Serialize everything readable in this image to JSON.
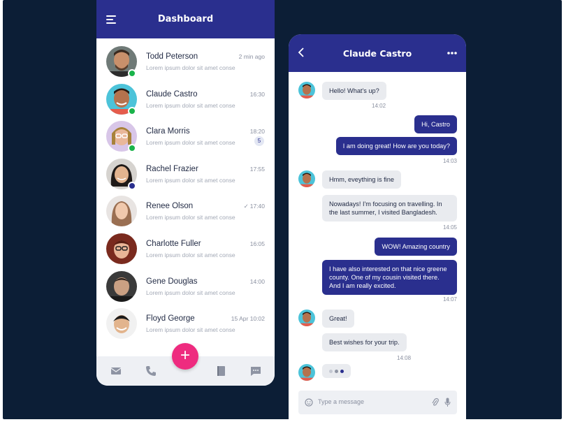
{
  "colors": {
    "primary": "#2a2f8e",
    "accent": "#ee2b7f",
    "online": "#19b34a",
    "background": "#0c1e36"
  },
  "dashboard": {
    "title": "Dashboard",
    "conversations": [
      {
        "name": "Todd Peterson",
        "preview": "Lorem ipsum dolor sit amet conse",
        "time": "2 min ago",
        "status": "online"
      },
      {
        "name": "Claude Castro",
        "preview": "Lorem ipsum dolor sit amet conse",
        "time": "16:30",
        "status": "online"
      },
      {
        "name": "Clara Morris",
        "preview": "Lorem ipsum dolor sit amet conse",
        "time": "18:20",
        "status": "online",
        "unread": "5"
      },
      {
        "name": "Rachel Frazier",
        "preview": "Lorem ipsum dolor sit amet conse",
        "time": "17:55",
        "status": "away"
      },
      {
        "name": "Renee Olson",
        "preview": "Lorem ipsum dolor sit amet conse",
        "time": "17:40",
        "read": "✓"
      },
      {
        "name": "Charlotte Fuller",
        "preview": "Lorem ipsum dolor sit amet conse",
        "time": "16:05"
      },
      {
        "name": "Gene Douglas",
        "preview": "Lorem ipsum dolor sit amet conse",
        "time": "14:00"
      },
      {
        "name": "Floyd George",
        "preview": "Lorem ipsum dolor sit amet conse",
        "time": "15 Apr 10:02"
      }
    ],
    "fab_label": "+",
    "footer_icons": [
      "mail-icon",
      "phone-icon",
      "book-icon",
      "chat-icon"
    ]
  },
  "chat": {
    "title": "Claude Castro",
    "messages": [
      {
        "from": "them",
        "text": "Hello! What's up?",
        "time": "14:02"
      },
      {
        "from": "me",
        "text": "Hi, Castro"
      },
      {
        "from": "me",
        "text": "I am doing great! How are you today?",
        "time": "14:03"
      },
      {
        "from": "them",
        "text": "Hmm, eveything is fine"
      },
      {
        "from": "them",
        "text": "Nowadays! I'm focusing on travelling. In the last summer, I visited Bangladesh.",
        "time": "14:05"
      },
      {
        "from": "me",
        "text": "WOW! Amazing country"
      },
      {
        "from": "me",
        "text": "I have also interested on that nice greene county. One of my cousin visited there. And I am really excited.",
        "time": "14:07"
      },
      {
        "from": "them",
        "text": "Great!"
      },
      {
        "from": "them",
        "text": "Best wishes for your trip.",
        "time": "14:08"
      }
    ],
    "composer_placeholder": "Type a message"
  }
}
